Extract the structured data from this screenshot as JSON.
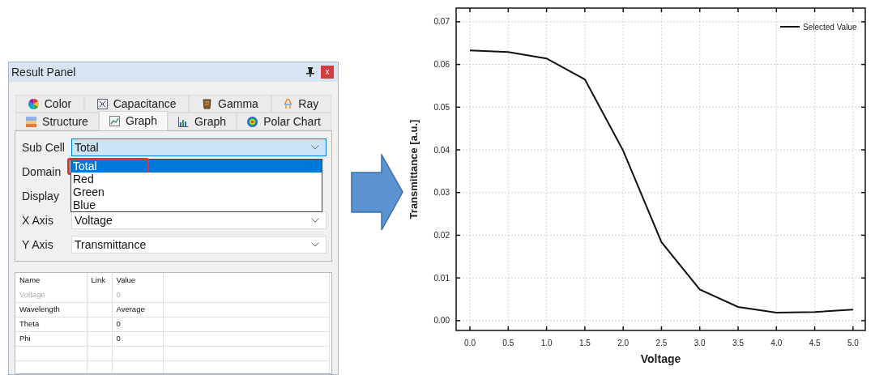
{
  "panel": {
    "title": "Result Panel",
    "close": "x",
    "tab_rows": [
      [
        {
          "label": "Color",
          "kind": "wheel",
          "selected": false
        },
        {
          "label": "Capacitance",
          "kind": "capacitance",
          "selected": false
        },
        {
          "label": "Gamma",
          "kind": "gamma",
          "selected": false
        },
        {
          "label": "Ray",
          "kind": "ray",
          "selected": false
        }
      ],
      [
        {
          "label": "Structure",
          "kind": "structure",
          "selected": false
        },
        {
          "label": "Graph",
          "kind": "line",
          "selected": true
        },
        {
          "label": "Graph",
          "kind": "bar",
          "selected": false
        },
        {
          "label": "Polar Chart",
          "kind": "polar",
          "selected": false
        }
      ]
    ],
    "fields": [
      {
        "label": "Sub Cell",
        "value": "Total",
        "open": true
      },
      {
        "label": "Domain"
      },
      {
        "label": "Display"
      },
      {
        "label": "X Axis",
        "value": "Voltage",
        "open": false
      },
      {
        "label": "Y Axis",
        "value": "Transmittance",
        "open": false
      }
    ],
    "dropdown": {
      "options": [
        {
          "label": "Total",
          "selected": true,
          "highlighted": true
        },
        {
          "label": "Red",
          "selected": false,
          "highlighted": false
        },
        {
          "label": "Green",
          "selected": false,
          "highlighted": false
        },
        {
          "label": "Blue",
          "selected": false,
          "highlighted": false
        }
      ]
    },
    "table": {
      "columns": [
        "Name",
        "Link",
        "Value"
      ],
      "rows": [
        {
          "cells": [
            "Voltage",
            "",
            "0"
          ],
          "disabled": true
        },
        {
          "cells": [
            "Wavelength",
            "",
            "Average"
          ],
          "disabled": false
        },
        {
          "cells": [
            "Theta",
            "",
            "0"
          ],
          "disabled": false
        },
        {
          "cells": [
            "Phi",
            "",
            "0"
          ],
          "disabled": false
        }
      ]
    }
  },
  "chart": {
    "chart_data": {
      "type": "line",
      "xlabel": "Voltage",
      "ylabel": "Transmittance [a.u.]",
      "x": [
        0,
        0.5,
        1,
        1.5,
        2,
        2.5,
        3,
        3.5,
        4,
        4.5,
        5
      ],
      "series": [
        {
          "name": "Selected Value",
          "color": "#111111",
          "values": [
            0.0633,
            0.0629,
            0.0614,
            0.0565,
            0.0398,
            0.0184,
            0.0073,
            0.0032,
            0.0019,
            0.002,
            0.0026
          ]
        }
      ],
      "grid": true,
      "xlim": [
        -0.18,
        5.16
      ],
      "ylim": [
        -0.0023,
        0.0732
      ],
      "xticks": [
        {
          "value": 0,
          "label": "0.0"
        },
        {
          "value": 0.5,
          "label": "0.5"
        },
        {
          "value": 1,
          "label": "1.0"
        },
        {
          "value": 1.5,
          "label": "1.5"
        },
        {
          "value": 2,
          "label": "2.0"
        },
        {
          "value": 2.5,
          "label": "2.5"
        },
        {
          "value": 3,
          "label": "3.0"
        },
        {
          "value": 3.5,
          "label": "3.5"
        },
        {
          "value": 4,
          "label": "4.0"
        },
        {
          "value": 4.5,
          "label": "4.5"
        },
        {
          "value": 5,
          "label": "5.0"
        }
      ],
      "yticks": [
        {
          "value": 0,
          "label": "0.00"
        },
        {
          "value": 0.01,
          "label": "0.01"
        },
        {
          "value": 0.02,
          "label": "0.02"
        },
        {
          "value": 0.03,
          "label": "0.03"
        },
        {
          "value": 0.04,
          "label": "0.04"
        },
        {
          "value": 0.05,
          "label": "0.05"
        },
        {
          "value": 0.06,
          "label": "0.06"
        },
        {
          "value": 0.07,
          "label": "0.07"
        }
      ]
    }
  }
}
